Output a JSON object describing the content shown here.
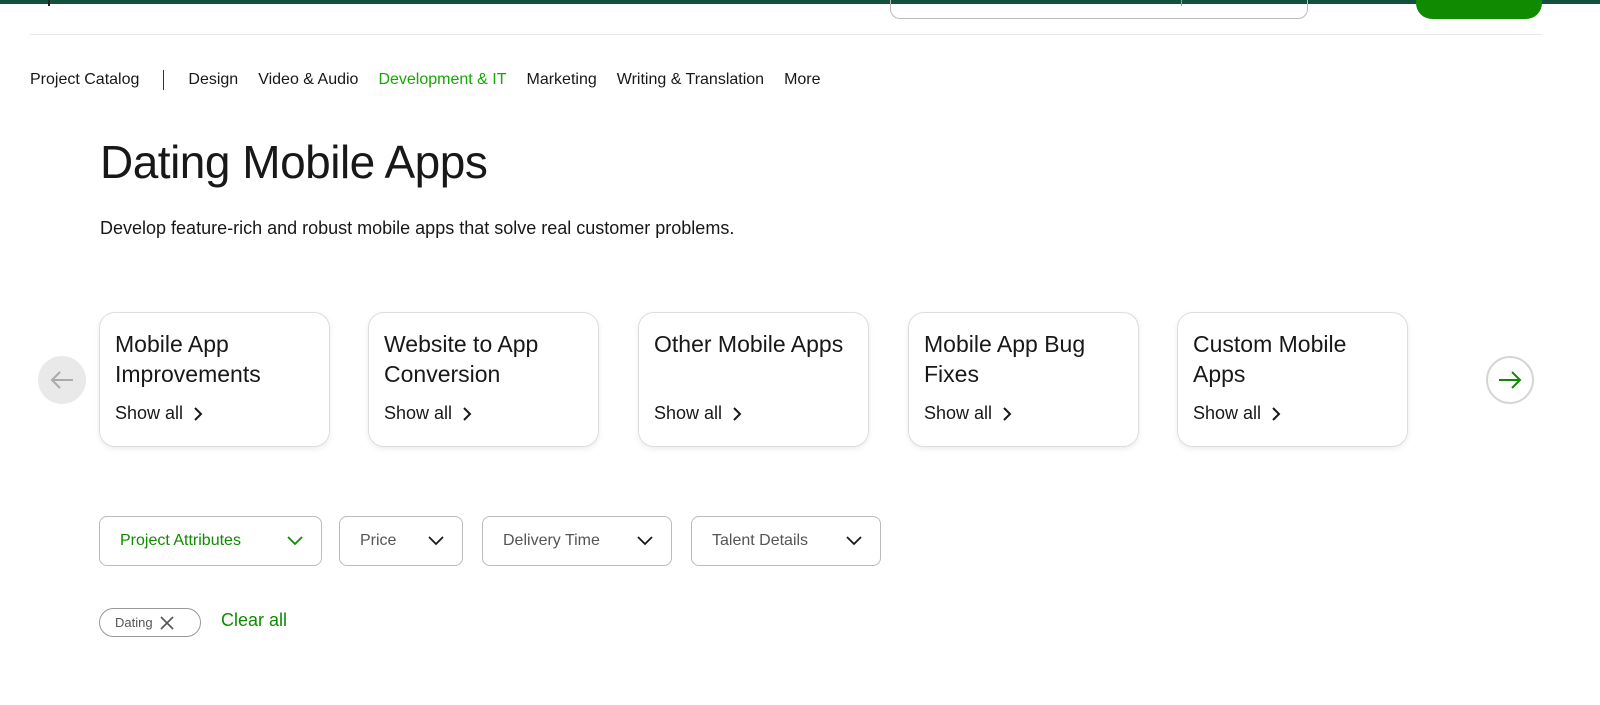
{
  "nav": {
    "title": "Project Catalog",
    "items": [
      {
        "label": "Design"
      },
      {
        "label": "Video & Audio"
      },
      {
        "label": "Development & IT",
        "active": true
      },
      {
        "label": "Marketing"
      },
      {
        "label": "Writing & Translation"
      },
      {
        "label": "More"
      }
    ]
  },
  "page": {
    "title": "Dating Mobile Apps",
    "description": "Develop feature-rich and robust mobile apps that solve real customer problems."
  },
  "categories": [
    {
      "title": "Mobile App Improvements",
      "link": "Show all"
    },
    {
      "title": "Website to App Conversion",
      "link": "Show all"
    },
    {
      "title": "Other Mobile Apps",
      "link": "Show all"
    },
    {
      "title": "Mobile App Bug Fixes",
      "link": "Show all"
    },
    {
      "title": "Custom Mobile Apps",
      "link": "Show all"
    }
  ],
  "filters": [
    {
      "label": "Project Attributes"
    },
    {
      "label": "Price"
    },
    {
      "label": "Delivery Time"
    },
    {
      "label": "Talent Details"
    }
  ],
  "active_filters": {
    "chip": "Dating",
    "clear": "Clear all"
  },
  "colors": {
    "accent": "#108a00",
    "topbar": "#14503e"
  }
}
